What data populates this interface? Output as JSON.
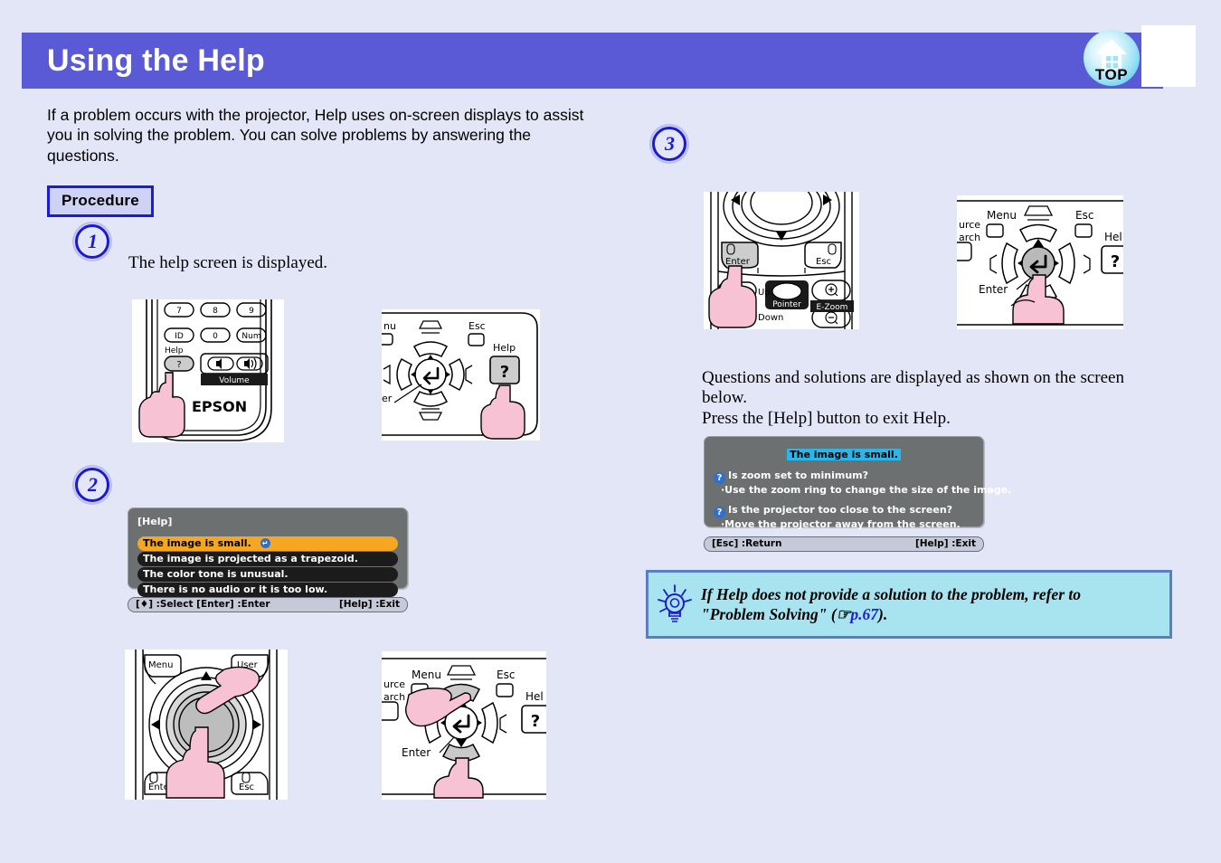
{
  "header": {
    "title": "Using the Help",
    "logo_label": "TOP",
    "logo_icon": "home-icon",
    "bar_color": "#5a5ad6"
  },
  "page": {
    "background_color": "#e3e6f7",
    "intro": "If a problem occurs with the projector, Help uses on-screen displays to assist you in solving the problem. You can solve problems by answering the questions.",
    "procedure_label": "Procedure"
  },
  "steps": [
    {
      "number": "1",
      "text": "The help screen is displayed.",
      "figures": [
        "remote-help-button",
        "panel-help-button"
      ]
    },
    {
      "number": "2",
      "text": "",
      "figures": [
        "remote-navigation-pad",
        "panel-navigation-arrows"
      ]
    },
    {
      "number": "3",
      "text": "Questions and solutions are displayed as shown on the screen below.\nPress the [Help] button to exit Help.",
      "text_line1": "Questions and solutions are displayed as shown on the screen",
      "text_line2": "below.",
      "text_line3": "Press the [Help] button to exit Help.",
      "figures": [
        "remote-enter-button",
        "panel-enter-button"
      ]
    }
  ],
  "remote_step1": {
    "buttons": [
      "7",
      "8",
      "9",
      "ID",
      "0",
      "Num"
    ],
    "help_label": "Help",
    "help_button": "?",
    "volume_label": "Volume",
    "brand": "EPSON"
  },
  "panel_step1": {
    "menu_label": "nu",
    "esc_label": "Esc",
    "help_label": "Help",
    "help_button": "?",
    "enter_label": "er"
  },
  "remote_step2": {
    "menu_label": "Menu",
    "user_label": "User",
    "enter_label": "Enter",
    "esc_label": "Esc"
  },
  "panel_step2": {
    "source_label": "urce",
    "search_label": "arch",
    "menu_label": "Menu",
    "esc_label": "Esc",
    "help_label": "Hel",
    "help_button": "?",
    "enter_label": "Enter"
  },
  "remote_step3": {
    "enter_label": "Enter",
    "esc_label": "Esc",
    "up_label": "Up",
    "down_label": "Down",
    "pointer_label": "Pointer",
    "ezoom_label": "E-Zoom"
  },
  "panel_step3": {
    "source_label": "urce",
    "search_label": "arch",
    "menu_label": "Menu",
    "esc_label": "Esc",
    "help_label": "Hel",
    "help_button": "?",
    "enter_label": "Enter"
  },
  "osd_menu": {
    "title": "[Help]",
    "items": [
      "The image is small.",
      "The image is projected as a trapezoid.",
      "The color tone is unusual.",
      "There is no audio or it is too low."
    ],
    "selected_index": 0,
    "selected_color": "#f5a623",
    "footer_left": "[♦] :Select  [Enter] :Enter",
    "footer_right": "[Help] :Exit"
  },
  "osd_answer": {
    "title": "The image is small.",
    "title_highlight_color": "#2ab6e8",
    "entries": [
      {
        "question": "Is zoom set to minimum?",
        "answer": "·Use the zoom ring to change the size of the image."
      },
      {
        "question": "Is the projector too close to the screen?",
        "answer": "·Move the projector away from the screen."
      }
    ],
    "footer_left": "[Esc] :Return",
    "footer_right": "[Help] :Exit"
  },
  "tip": {
    "icon": "lightbulb-icon",
    "line1_a": "If Help does not provide a solution to the problem, refer to",
    "line2_a": "\"Problem Solving\" (",
    "link": "p.67",
    "line2_b": ").",
    "background_color": "#a8e4ef",
    "border_color": "#5a7fc0",
    "link_color": "#2020cc"
  }
}
